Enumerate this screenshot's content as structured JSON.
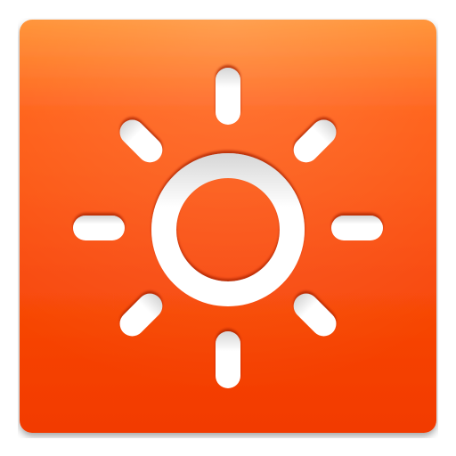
{
  "icon": {
    "name": "brightness-sun-icon",
    "description_label": "",
    "colors": {
      "tile_top": "#ff8c2a",
      "tile_mid": "#ff5a10",
      "tile_bottom": "#f23a00",
      "tile_edge": "#d83000",
      "glyph": "#ffffff",
      "glyph_inner_shadow": "#cfcfcf",
      "carved_shadow": "#b32600"
    }
  }
}
